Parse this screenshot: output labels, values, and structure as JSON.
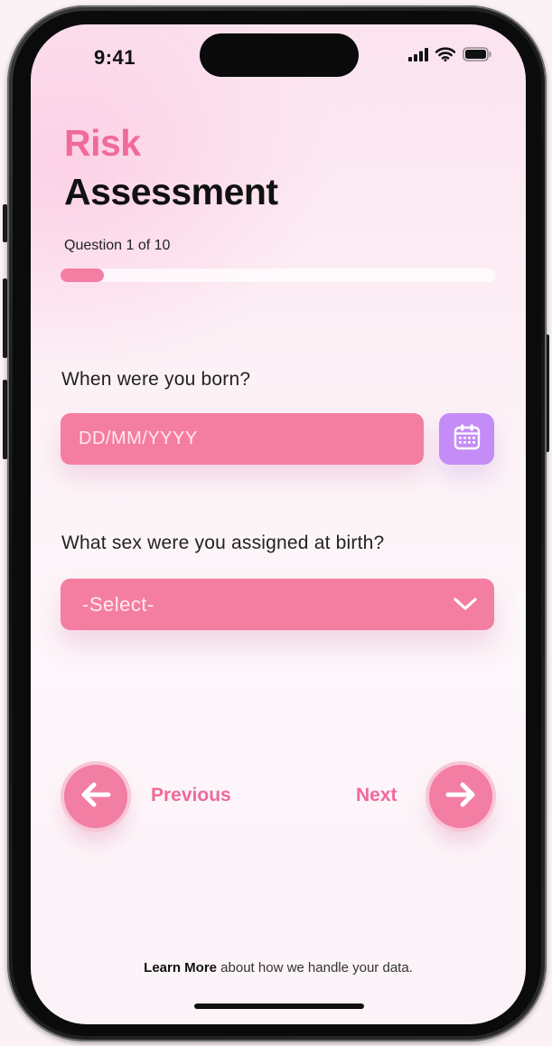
{
  "status_bar": {
    "time": "9:41",
    "icons": [
      "cellular-signal-icon",
      "wifi-icon",
      "battery-icon"
    ]
  },
  "header": {
    "title_accent": "Risk",
    "title_main": "Assessment"
  },
  "progress": {
    "label": "Question 1 of 10",
    "current": 1,
    "total": 10,
    "fraction": 0.1
  },
  "questions": [
    {
      "label": "When were you born?",
      "input_placeholder": "DD/MM/YYYY",
      "button_icon": "calendar-icon"
    },
    {
      "label": "What sex were you assigned at birth?",
      "select_value": "-Select-",
      "icon": "chevron-down-icon"
    }
  ],
  "navigation": {
    "previous_label": "Previous",
    "next_label": "Next"
  },
  "footer": {
    "link_text": "Learn More",
    "text": " about how we handle your data."
  },
  "colors": {
    "accent_pink": "#f27ea3",
    "accent_text_pink": "#f06a9a",
    "calendar_purple": "#c48cf6",
    "background": "#fbf2f6"
  }
}
